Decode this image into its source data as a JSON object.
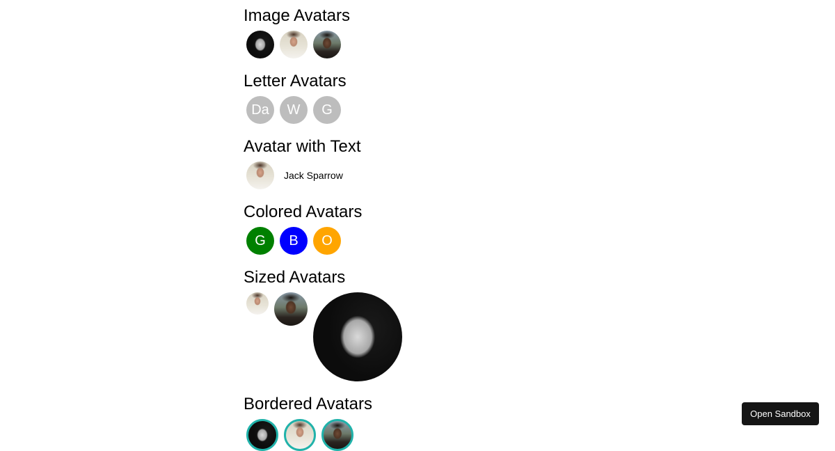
{
  "sections": {
    "image_avatars": {
      "title": "Image Avatars",
      "avatars": [
        "woman-photo",
        "man-photo-1",
        "man-photo-2"
      ]
    },
    "letter_avatars": {
      "title": "Letter Avatars",
      "letters": [
        "Da",
        "W",
        "G"
      ],
      "background": "#bdbdbd"
    },
    "avatar_with_text": {
      "title": "Avatar with Text",
      "name": "Jack Sparrow"
    },
    "colored_avatars": {
      "title": "Colored Avatars",
      "items": [
        {
          "letter": "G",
          "color": "#008000"
        },
        {
          "letter": "B",
          "color": "#0000ff"
        },
        {
          "letter": "O",
          "color": "#ffa500"
        }
      ]
    },
    "sized_avatars": {
      "title": "Sized Avatars",
      "sizes": [
        "small",
        "medium",
        "large"
      ]
    },
    "bordered_avatars": {
      "title": "Bordered Avatars",
      "border_color": "#20b2aa"
    }
  },
  "open_sandbox_label": "Open Sandbox"
}
